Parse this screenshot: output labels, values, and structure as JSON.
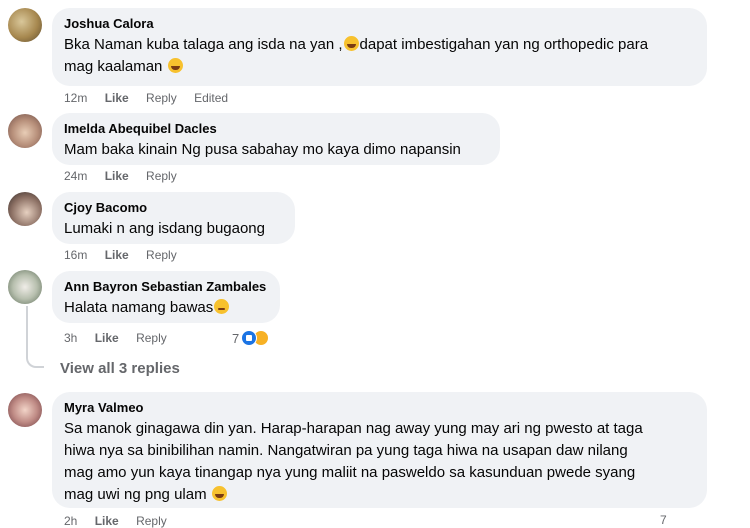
{
  "comments": [
    {
      "name": "Joshua Calora",
      "text_part1": "Bka Naman kuba talaga ang isda na yan ,",
      "text_part2": "dapat imbestigahan yan ng orthopedic para",
      "text_line2": "mag kaalaman",
      "time": "12m",
      "like": "Like",
      "reply": "Reply",
      "edited": "Edited"
    },
    {
      "name": "Imelda Abequibel Dacles",
      "text": "Mam baka kinain Ng pusa sabahay mo kaya dimo napansin",
      "time": "24m",
      "like": "Like",
      "reply": "Reply"
    },
    {
      "name": "Cjoy Bacomo",
      "text": "Lumaki n ang isdang bugaong",
      "time": "16m",
      "like": "Like",
      "reply": "Reply"
    },
    {
      "name": "Ann Bayron Sebastian Zambales",
      "text": "Halata namang bawas",
      "time": "3h",
      "like": "Like",
      "reply": "Reply",
      "reaction_count": "7"
    },
    {
      "name": "Myra Valmeo",
      "lines": [
        "Sa manok ginagawa din yan. Harap-harapan nag away yung may ari ng pwesto at taga",
        "hiwa nya sa binibilihan namin. Nangatwiran pa yung taga hiwa na usapan daw nilang",
        "mag amo yun kaya tinangap nya yung maliit na pasweldo sa kasunduan pwede syang",
        "mag uwi ng png ulam"
      ],
      "time": "2h",
      "like": "Like",
      "reply": "Reply",
      "reaction_count": "7"
    }
  ],
  "view_replies": "View all 3 replies"
}
